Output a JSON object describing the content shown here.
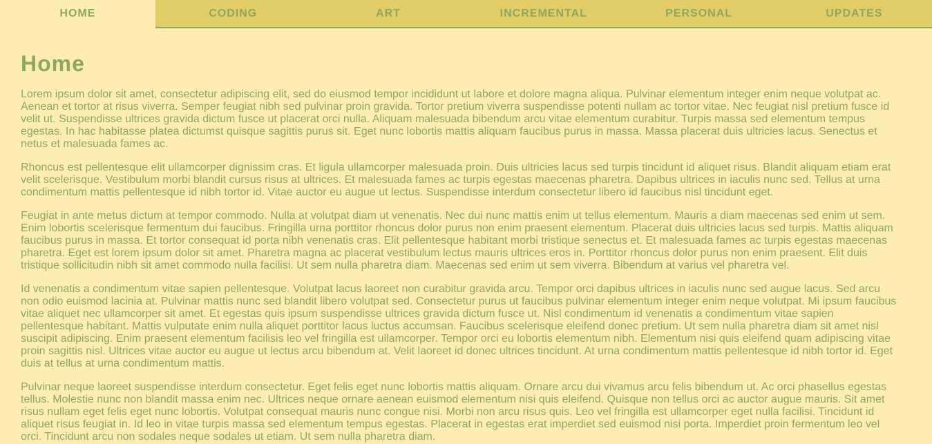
{
  "nav": {
    "tabs": [
      {
        "label": "HOME"
      },
      {
        "label": "CODING"
      },
      {
        "label": "ART"
      },
      {
        "label": "INCREMENTAL"
      },
      {
        "label": "PERSONAL"
      },
      {
        "label": "UPDATES"
      }
    ]
  },
  "page": {
    "title": "Home",
    "paragraphs": [
      "Lorem ipsum dolor sit amet, consectetur adipiscing elit, sed do eiusmod tempor incididunt ut labore et dolore magna aliqua. Pulvinar elementum integer enim neque volutpat ac. Aenean et tortor at risus viverra. Semper feugiat nibh sed pulvinar proin gravida. Tortor pretium viverra suspendisse potenti nullam ac tortor vitae. Nec feugiat nisl pretium fusce id velit ut. Suspendisse ultrices gravida dictum fusce ut placerat orci nulla. Aliquam malesuada bibendum arcu vitae elementum curabitur. Turpis massa sed elementum tempus egestas. In hac habitasse platea dictumst quisque sagittis purus sit. Eget nunc lobortis mattis aliquam faucibus purus in massa. Massa placerat duis ultricies lacus. Senectus et netus et malesuada fames ac.",
      "Rhoncus est pellentesque elit ullamcorper dignissim cras. Et ligula ullamcorper malesuada proin. Duis ultricies lacus sed turpis tincidunt id aliquet risus. Blandit aliquam etiam erat velit scelerisque. Vestibulum morbi blandit cursus risus at ultrices. Et malesuada fames ac turpis egestas maecenas pharetra. Dapibus ultrices in iaculis nunc sed. Tellus at urna condimentum mattis pellentesque id nibh tortor id. Vitae auctor eu augue ut lectus. Suspendisse interdum consectetur libero id faucibus nisl tincidunt eget.",
      "Feugiat in ante metus dictum at tempor commodo. Nulla at volutpat diam ut venenatis. Nec dui nunc mattis enim ut tellus elementum. Mauris a diam maecenas sed enim ut sem. Enim lobortis scelerisque fermentum dui faucibus. Fringilla urna porttitor rhoncus dolor purus non enim praesent elementum. Placerat duis ultricies lacus sed turpis. Mattis aliquam faucibus purus in massa. Et tortor consequat id porta nibh venenatis cras. Elit pellentesque habitant morbi tristique senectus et. Et malesuada fames ac turpis egestas maecenas pharetra. Eget est lorem ipsum dolor sit amet. Pharetra magna ac placerat vestibulum lectus mauris ultrices eros in. Porttitor rhoncus dolor purus non enim praesent. Elit duis tristique sollicitudin nibh sit amet commodo nulla facilisi. Ut sem nulla pharetra diam. Maecenas sed enim ut sem viverra. Bibendum at varius vel pharetra vel.",
      "Id venenatis a condimentum vitae sapien pellentesque. Volutpat lacus laoreet non curabitur gravida arcu. Tempor orci dapibus ultrices in iaculis nunc sed augue lacus. Sed arcu non odio euismod lacinia at. Pulvinar mattis nunc sed blandit libero volutpat sed. Consectetur purus ut faucibus pulvinar elementum integer enim neque volutpat. Mi ipsum faucibus vitae aliquet nec ullamcorper sit amet. Et egestas quis ipsum suspendisse ultrices gravida dictum fusce ut. Nisl condimentum id venenatis a condimentum vitae sapien pellentesque habitant. Mattis vulputate enim nulla aliquet porttitor lacus luctus accumsan. Faucibus scelerisque eleifend donec pretium. Ut sem nulla pharetra diam sit amet nisl suscipit adipiscing. Enim praesent elementum facilisis leo vel fringilla est ullamcorper. Tempor orci eu lobortis elementum nibh. Elementum nisi quis eleifend quam adipiscing vitae proin sagittis nisl. Ultrices vitae auctor eu augue ut lectus arcu bibendum at. Velit laoreet id donec ultrices tincidunt. At urna condimentum mattis pellentesque id nibh tortor id. Eget duis at tellus at urna condimentum mattis.",
      "Pulvinar neque laoreet suspendisse interdum consectetur. Eget felis eget nunc lobortis mattis aliquam. Ornare arcu dui vivamus arcu felis bibendum ut. Ac orci phasellus egestas tellus. Molestie nunc non blandit massa enim nec. Ultrices neque ornare aenean euismod elementum nisi quis eleifend. Quisque non tellus orci ac auctor augue mauris. Sit amet risus nullam eget felis eget nunc lobortis. Volutpat consequat mauris nunc congue nisi. Morbi non arcu risus quis. Leo vel fringilla est ullamcorper eget nulla facilisi. Tincidunt id aliquet risus feugiat in. Id leo in vitae turpis massa sed elementum tempus egestas. Placerat in egestas erat imperdiet sed euismod nisi porta. Imperdiet proin fermentum leo vel orci. Tincidunt arcu non sodales neque sodales ut etiam. Ut sem nulla pharetra diam."
    ]
  },
  "colors": {
    "background": "#feedb3",
    "nav_background": "#e2cd67",
    "accent": "#8ea660"
  }
}
